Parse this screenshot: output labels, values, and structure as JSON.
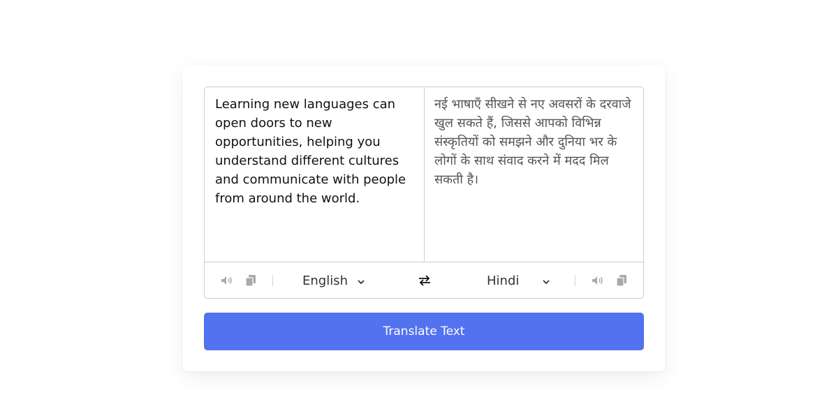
{
  "translator": {
    "from_text": "Learning new languages can open doors to new opportunities, helping you understand different cultures and communicate with people from around the world.",
    "to_text": "नई भाषाएँ सीखने से नए अवसरों के दरवाजे खुल सकते हैं, जिससे आपको विभिन्न संस्कृतियों को समझने और दुनिया भर के लोगों के साथ संवाद करने में मदद मिल सकती है।",
    "from_language": "English",
    "to_language": "Hindi",
    "translate_button_label": "Translate Text"
  },
  "icons": {
    "speaker": "volume-icon",
    "copy": "copy-icon",
    "exchange": "exchange-arrows-icon",
    "dropdown": "chevron-down-icon"
  },
  "colors": {
    "accent": "#5372f0",
    "icon_gray": "#a9a9a9",
    "border": "#cfcfcf"
  }
}
